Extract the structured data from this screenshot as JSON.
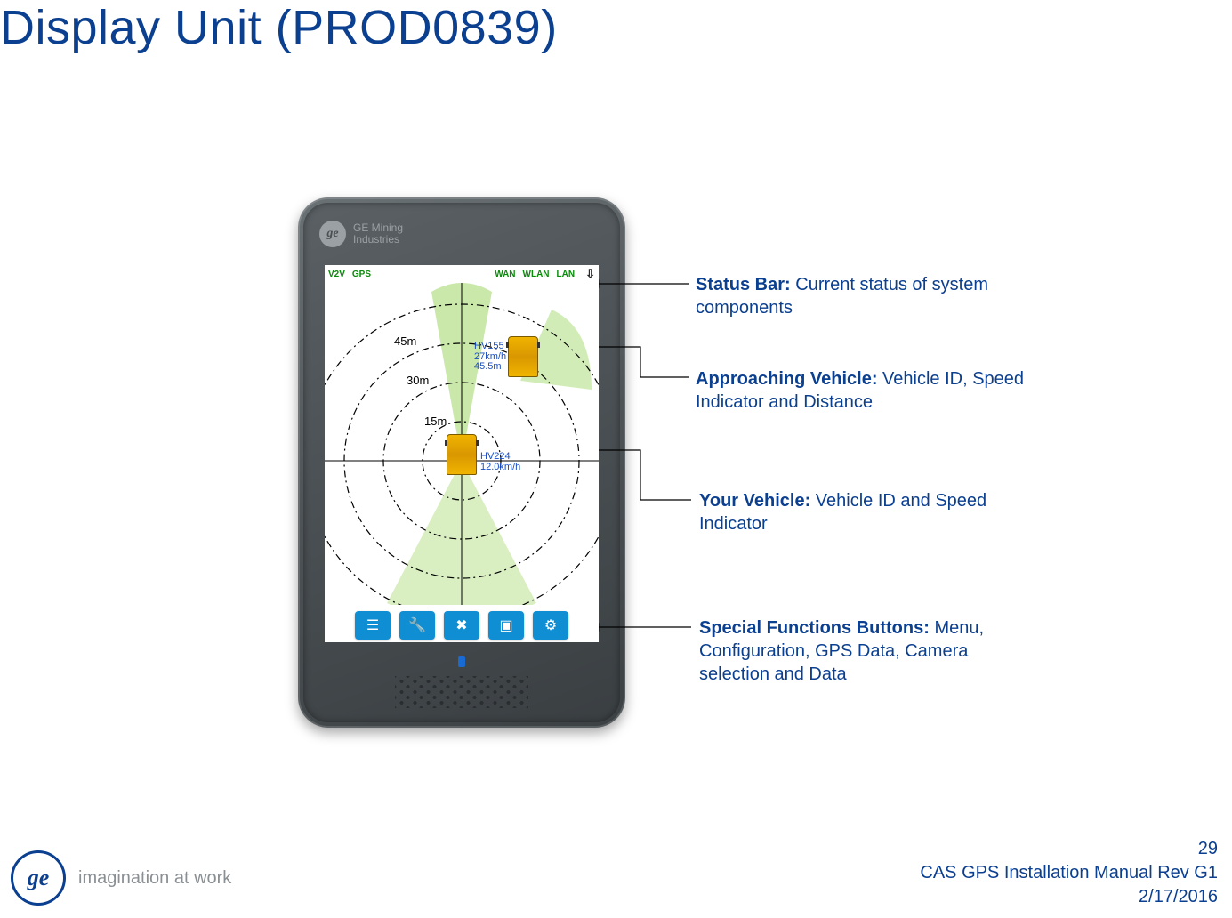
{
  "title": "Display Unit (PROD0839)",
  "device_brand_line1": "GE Mining",
  "device_brand_line2": "Industries",
  "status_bar": {
    "v2v": "V2V",
    "gps": "GPS",
    "wan": "WAN",
    "wlan": "WLAN",
    "lan": "LAN"
  },
  "radar": {
    "ring_labels": {
      "r45": "45m",
      "r30": "30m",
      "r15": "15m"
    },
    "approaching": {
      "id": "HV155",
      "speed": "27km/h",
      "distance": "45.5m"
    },
    "own": {
      "id": "HV224",
      "speed": "12.0km/h"
    }
  },
  "annotations": {
    "status_bar": {
      "label": "Status Bar:",
      "desc": " Current  status of system components"
    },
    "approaching": {
      "label": "Approaching Vehicle:",
      "desc": " Vehicle ID, Speed Indicator and Distance"
    },
    "your_vehicle": {
      "label": "Your Vehicle:",
      "desc": " Vehicle ID and Speed Indicator"
    },
    "functions": {
      "label": "Special Functions Buttons:",
      "desc": " Menu, Configuration, GPS Data, Camera selection and Data"
    }
  },
  "footer": {
    "tagline": "imagination at work",
    "page_number": "29",
    "doc_title": "CAS GPS Installation Manual Rev G1",
    "date": "2/17/2016"
  }
}
